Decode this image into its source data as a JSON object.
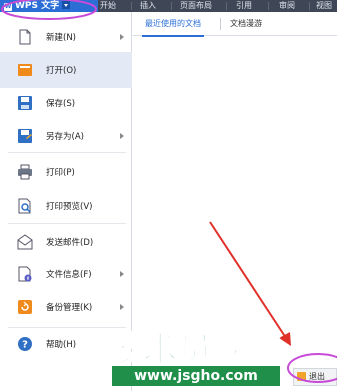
{
  "titlebar": {
    "app_name": "WPS 文字",
    "logo_glyph": "W",
    "ribbon_tabs": [
      "开始",
      "插入",
      "页面布局",
      "引用",
      "审阅",
      "视图"
    ]
  },
  "menu": {
    "items": [
      {
        "label": "新建(N)",
        "icon": "new-document-icon",
        "submenu": true
      },
      {
        "label": "打开(O)",
        "icon": "open-folder-icon",
        "submenu": false,
        "active": true
      },
      {
        "label": "保存(S)",
        "icon": "save-icon",
        "submenu": false
      },
      {
        "label": "另存为(A)",
        "icon": "save-as-icon",
        "submenu": true
      },
      {
        "label": "打印(P)",
        "icon": "printer-icon",
        "submenu": false
      },
      {
        "label": "打印预览(V)",
        "icon": "print-preview-icon",
        "submenu": false
      },
      {
        "label": "发送邮件(D)",
        "icon": "mail-icon",
        "submenu": false
      },
      {
        "label": "文件信息(F)",
        "icon": "file-info-icon",
        "submenu": true
      },
      {
        "label": "备份管理(K)",
        "icon": "backup-icon",
        "submenu": true
      },
      {
        "label": "帮助(H)",
        "icon": "help-icon",
        "submenu": false
      }
    ]
  },
  "panel": {
    "tabs": [
      "最近使用的文档",
      "文档漫游"
    ],
    "exit_label": "退出"
  },
  "watermark": {
    "main": "技术员联盟",
    "url": "www.jsgho.com"
  },
  "colors": {
    "accent": "#2b6fd6",
    "ribbon": "#3f4757",
    "active_row": "#e3eaf6",
    "annotation_red": "#e0302a",
    "annotation_magenta": "#c84bd8",
    "watermark_green": "#1f8f4a"
  }
}
